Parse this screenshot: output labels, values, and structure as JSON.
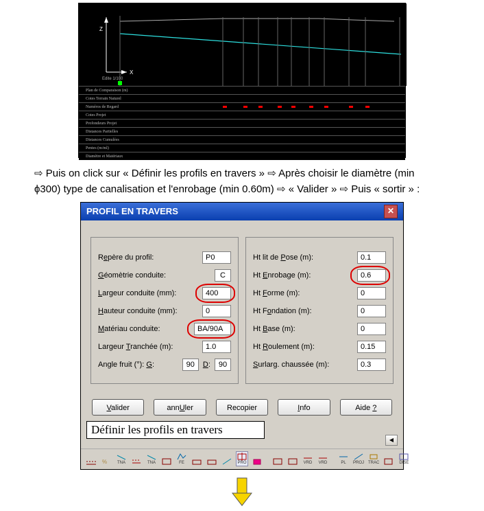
{
  "chart_data": {
    "type": "profile-table",
    "axes": {
      "x_label": "X",
      "z_label": "Z",
      "origin_label": "Edite 1/100"
    },
    "row_labels": [
      "Plan de Comparaison (m)",
      "Cotes Terrain Naturel",
      "Numéros de Regard",
      "Cotes Projet",
      "Profondeurs Projet",
      "Distances Partielles",
      "Distances Cumulées",
      "Pentes (m/ml)",
      "Diamètre et Matériaux"
    ]
  },
  "instruction": {
    "line1_pre": "⇨ Puis on click sur « Définir les profils en travers » ⇨ Après choisir le diamètre (min",
    "line2": "ϕ300) type de canalisation et l'enrobage (min 0.60m)  ⇨  « Valider » ⇨ Puis « sortir » :"
  },
  "dialog": {
    "title": "PROFIL EN TRAVERS",
    "left": {
      "repere_label_pre": "R",
      "repere_label_mid": "e",
      "repere_label_post": "père du profil:",
      "repere_value": "P0",
      "geom_label_pre": "",
      "geom_label_u": "G",
      "geom_label_post": "éomètrie conduite:",
      "geom_value": "C",
      "largeur_label_u": "L",
      "largeur_label_post": "argeur conduite (mm):",
      "largeur_value": "400",
      "hauteur_label_u": "H",
      "hauteur_label_post": "auteur conduite (mm):",
      "hauteur_value": "0",
      "materiau_label_u": "M",
      "materiau_label_post": "atériau conduite:",
      "materiau_value": "BA/90A",
      "tranchee_label_pre": "Largeur ",
      "tranchee_label_u": "T",
      "tranchee_label_post": "ranchée (m):",
      "tranchee_value": "1.0",
      "angle_label_pre": "Angle fruit (°): ",
      "angle_label_u": "G",
      "angle_label_post": ":",
      "angle_g_value": "90",
      "angle_d_label_u": "D",
      "angle_d_label_post": ":",
      "angle_d_value": "90"
    },
    "right": {
      "pose_label_pre": "Ht lit de ",
      "pose_label_u": "P",
      "pose_label_post": "ose    (m):",
      "pose_value": "0.1",
      "enrob_label_pre": "Ht ",
      "enrob_label_u": "E",
      "enrob_label_post": "nrobage    (m):",
      "enrob_value": "0.6",
      "forme_label_pre": "Ht ",
      "forme_label_u": "F",
      "forme_label_post": "orme        (m):",
      "forme_value": "0",
      "fond_label_pre": "Ht F",
      "fond_label_u": "o",
      "fond_label_post": "ndation    (m):",
      "fond_value": "0",
      "base_label_pre": "Ht ",
      "base_label_u": "B",
      "base_label_post": "ase          (m):",
      "base_value": "0",
      "roul_label_pre": "Ht ",
      "roul_label_u": "R",
      "roul_label_post": "oulement    (m):",
      "roul_value": "0.15",
      "surl_label_pre": "",
      "surl_label_u": "S",
      "surl_label_post": "urlarg. chaussée (m):",
      "surl_value": "0.3"
    },
    "buttons": {
      "valider_u": "V",
      "valider_post": "alider",
      "annuler_pre": "ann",
      "annuler_u": "U",
      "annuler_post": "ler",
      "recopier": "Recopier",
      "info_u": "I",
      "info_post": "nfo",
      "aide_pre": "Aide ",
      "aide_u": "?"
    },
    "bottom_label": "Définir les profils en travers",
    "toolbar": [
      "",
      "",
      "TNA",
      "",
      "TNA",
      "",
      "FE",
      "",
      "",
      "",
      "PRO",
      "",
      "",
      "",
      "VRD",
      "VRD",
      "",
      "PL",
      "PROJ",
      "TRAC",
      "",
      "DISE"
    ]
  }
}
